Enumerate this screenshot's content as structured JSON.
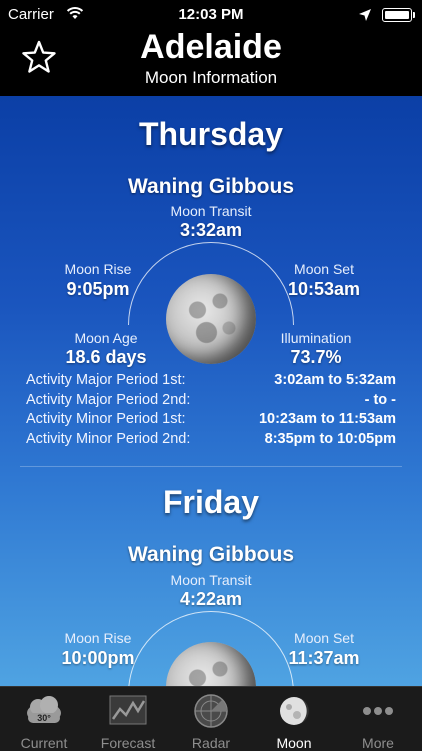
{
  "status_bar": {
    "carrier": "Carrier",
    "time": "12:03 PM"
  },
  "header": {
    "city": "Adelaide",
    "subtitle": "Moon Information"
  },
  "days": [
    {
      "day": "Thursday",
      "phase": "Waning Gibbous",
      "transit_label": "Moon Transit",
      "transit_value": "3:32am",
      "rise_label": "Moon Rise",
      "rise_value": "9:05pm",
      "set_label": "Moon Set",
      "set_value": "10:53am",
      "age_label": "Moon Age",
      "age_value": "18.6 days",
      "illum_label": "Illumination",
      "illum_value": "73.7%",
      "activity": [
        {
          "label": "Activity Major Period 1st:",
          "value": "3:02am to 5:32am"
        },
        {
          "label": "Activity Major Period 2nd:",
          "value": "- to -"
        },
        {
          "label": "Activity Minor Period 1st:",
          "value": "10:23am to 11:53am"
        },
        {
          "label": "Activity Minor Period 2nd:",
          "value": "8:35pm to 10:05pm"
        }
      ]
    },
    {
      "day": "Friday",
      "phase": "Waning Gibbous",
      "transit_label": "Moon Transit",
      "transit_value": "4:22am",
      "rise_label": "Moon Rise",
      "rise_value": "10:00pm",
      "set_label": "Moon Set",
      "set_value": "11:37am"
    }
  ],
  "tabs": [
    {
      "label": "Current",
      "icon": "cloud-temp-icon",
      "badge": "30°",
      "active": false
    },
    {
      "label": "Forecast",
      "icon": "chart-icon",
      "active": false
    },
    {
      "label": "Radar",
      "icon": "radar-icon",
      "active": false
    },
    {
      "label": "Moon",
      "icon": "moon-icon",
      "active": true
    },
    {
      "label": "More",
      "icon": "more-icon",
      "active": false
    }
  ],
  "colors": {
    "accent": "#1a55be",
    "tab_bar": "#1b1b1b",
    "header": "#000000"
  }
}
